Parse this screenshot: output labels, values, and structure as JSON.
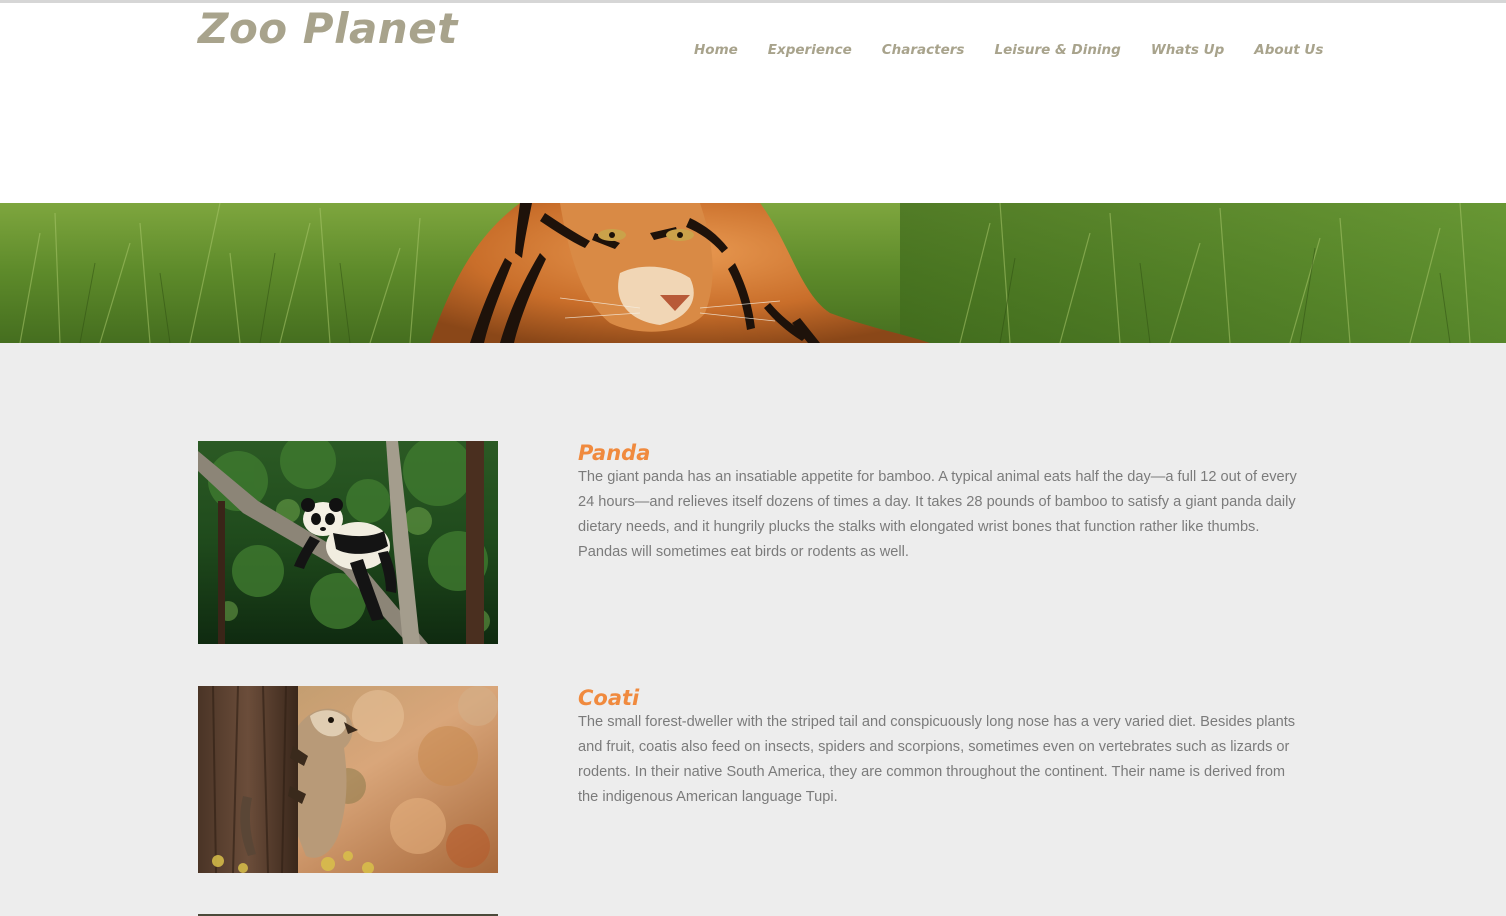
{
  "site": {
    "logo": "Zoo Planet",
    "nav": [
      {
        "label": "Home"
      },
      {
        "label": "Experience"
      },
      {
        "label": "Characters"
      },
      {
        "label": "Leisure & Dining"
      },
      {
        "label": "Whats Up"
      },
      {
        "label": "About Us"
      }
    ]
  },
  "colors": {
    "logo_nav": "#a8a38c",
    "animal_heading": "#f08a3e",
    "body_text": "#7b7b7b",
    "content_bg": "#ededed"
  },
  "hero": {
    "icon": "tiger-in-grass-banner"
  },
  "animals": [
    {
      "name": "Panda",
      "description": "The giant panda has an insatiable appetite for bamboo. A typical animal eats half the day—a full 12 out of every 24 hours—and relieves itself dozens of times a day. It takes 28 pounds of bamboo to satisfy a giant panda daily dietary needs, and it hungrily plucks the stalks with elongated wrist bones that function rather like thumbs. Pandas will sometimes eat birds or rodents as well.",
      "image": "panda-in-tree-photo"
    },
    {
      "name": "Coati",
      "description": "The small forest-dweller with the striped tail and conspicuously long nose has a very varied diet. Besides plants and fruit, coatis also feed on insects, spiders and scorpions, sometimes even on vertebrates such as lizards or rodents. In their native South America, they are common throughout the continent. Their name is derived from the indigenous American language Tupi.",
      "image": "coati-on-tree-photo"
    }
  ]
}
